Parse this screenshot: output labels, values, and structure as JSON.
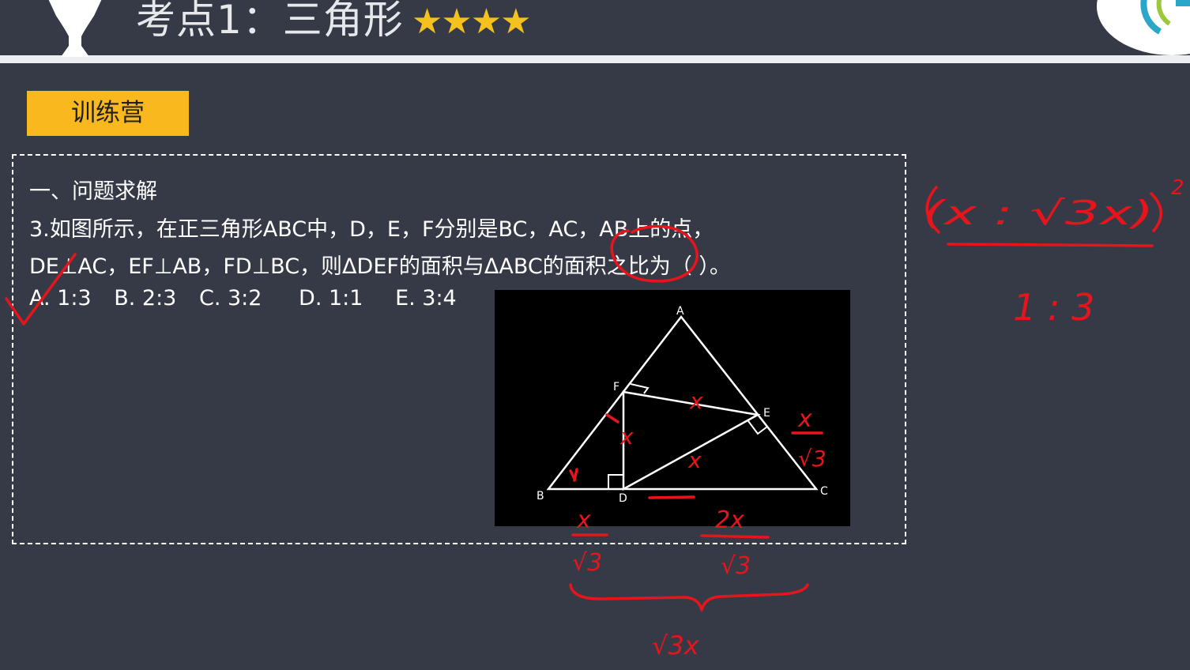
{
  "header": {
    "title": "考点1：三角形",
    "stars": "★★★★"
  },
  "badge": {
    "label": "训练营"
  },
  "question": {
    "section": "一、问题求解",
    "line1": "3.如图所示，在正三角形ABC中，D，E，F分别是BC，AC，AB上的点，",
    "line2": "DE⊥AC，EF⊥AB，FD⊥BC，则ΔDEF的面积与ΔABC的面积之比为（  ）。",
    "options": [
      "A. 1:3",
      "B. 2:3",
      "C. 3:2",
      "D. 1:1",
      "E. 3:4"
    ]
  },
  "figure": {
    "labels": {
      "A": "A",
      "B": "B",
      "C": "C",
      "D": "D",
      "E": "E",
      "F": "F"
    }
  },
  "colors": {
    "background": "#363a47",
    "badge": "#f9b91e",
    "stars": "#f5c11f",
    "ink": "#e8141c"
  },
  "annotations": {
    "side_x": "x",
    "left_seg_num": "x",
    "left_seg_den": "√3",
    "right_seg_num": "2x",
    "right_seg_den": "√3",
    "base_total": "√3x",
    "ec_num": "x",
    "ec_den": "√3",
    "ratio_top": "(x : √3x)",
    "ratio_exp": "2",
    "ratio_bottom": "1 : 3"
  }
}
